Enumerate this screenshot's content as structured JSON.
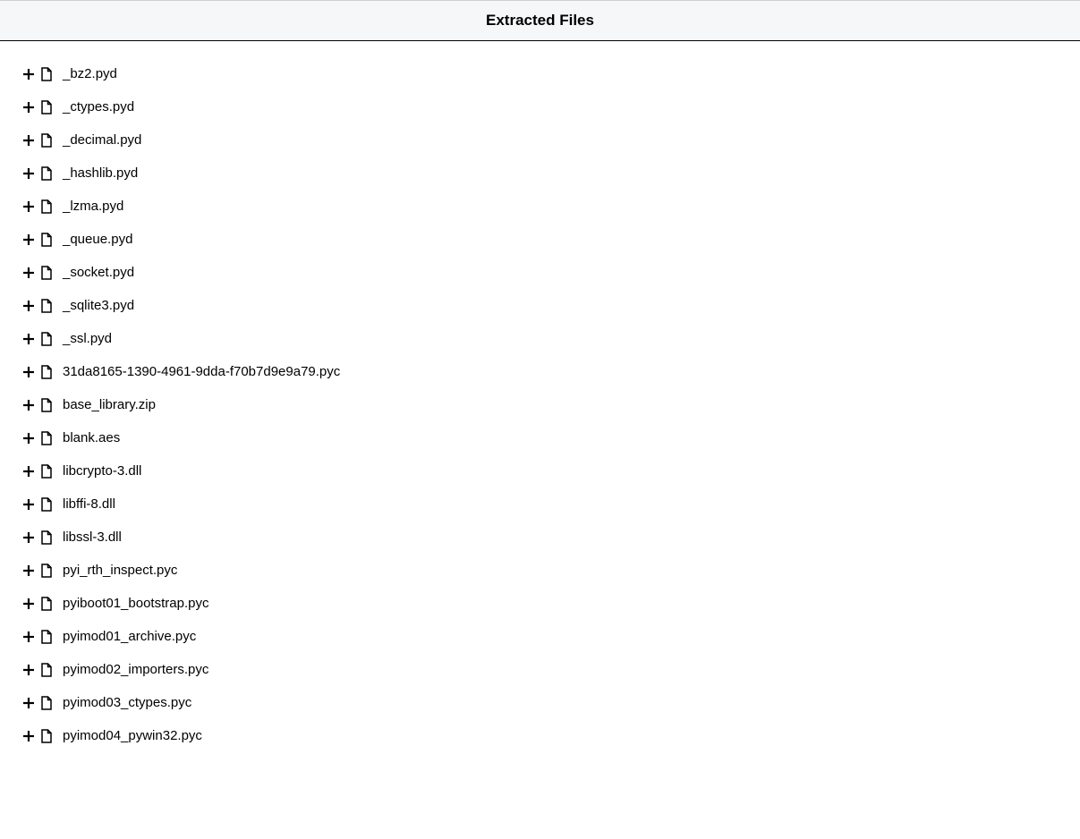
{
  "header": {
    "title": "Extracted Files"
  },
  "files": [
    {
      "name": "_bz2.pyd"
    },
    {
      "name": "_ctypes.pyd"
    },
    {
      "name": "_decimal.pyd"
    },
    {
      "name": "_hashlib.pyd"
    },
    {
      "name": "_lzma.pyd"
    },
    {
      "name": "_queue.pyd"
    },
    {
      "name": "_socket.pyd"
    },
    {
      "name": "_sqlite3.pyd"
    },
    {
      "name": "_ssl.pyd"
    },
    {
      "name": "31da8165-1390-4961-9dda-f70b7d9e9a79.pyc"
    },
    {
      "name": "base_library.zip"
    },
    {
      "name": "blank.aes"
    },
    {
      "name": "libcrypto-3.dll"
    },
    {
      "name": "libffi-8.dll"
    },
    {
      "name": "libssl-3.dll"
    },
    {
      "name": "pyi_rth_inspect.pyc"
    },
    {
      "name": "pyiboot01_bootstrap.pyc"
    },
    {
      "name": "pyimod01_archive.pyc"
    },
    {
      "name": "pyimod02_importers.pyc"
    },
    {
      "name": "pyimod03_ctypes.pyc"
    },
    {
      "name": "pyimod04_pywin32.pyc"
    }
  ]
}
